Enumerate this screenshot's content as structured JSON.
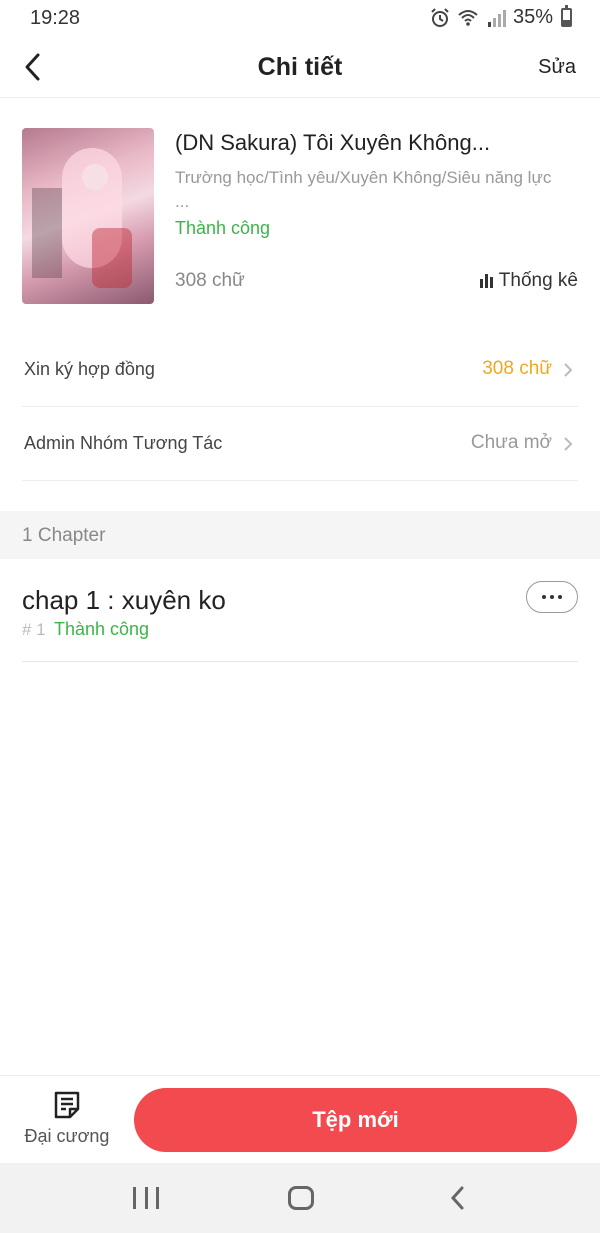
{
  "status_bar": {
    "time": "19:28",
    "battery": "35%",
    "icons": [
      "alarm-icon",
      "wifi-icon",
      "signal-icon",
      "battery-icon"
    ]
  },
  "header": {
    "title": "Chi tiết",
    "edit_label": "Sửa",
    "back_icon": "chevron-left-icon"
  },
  "book": {
    "title": "(DN Sakura) Tôi Xuyên Không...",
    "tags": "Trường học/Tình yêu/Xuyên Không/Siêu năng lực",
    "tags_overflow": "...",
    "status": "Thành công",
    "words": "308 chữ",
    "stats_label": "Thống kê"
  },
  "rows": [
    {
      "label": "Xin ký hợp đồng",
      "value": "308 chữ",
      "color": "#f0a81f"
    },
    {
      "label": "Admin Nhóm Tương Tác",
      "value": "Chưa mở",
      "color": "#999999"
    }
  ],
  "section": {
    "label": "1 Chapter"
  },
  "chapters": [
    {
      "title": "chap 1 : xuyên ko",
      "number": "# 1",
      "status": "Thành công"
    }
  ],
  "bottom_bar": {
    "outline_label": "Đại cương",
    "new_label": "Tệp mới"
  },
  "colors": {
    "accent": "#f24a4f",
    "success": "#3bb54a",
    "warning": "#f0a81f"
  }
}
